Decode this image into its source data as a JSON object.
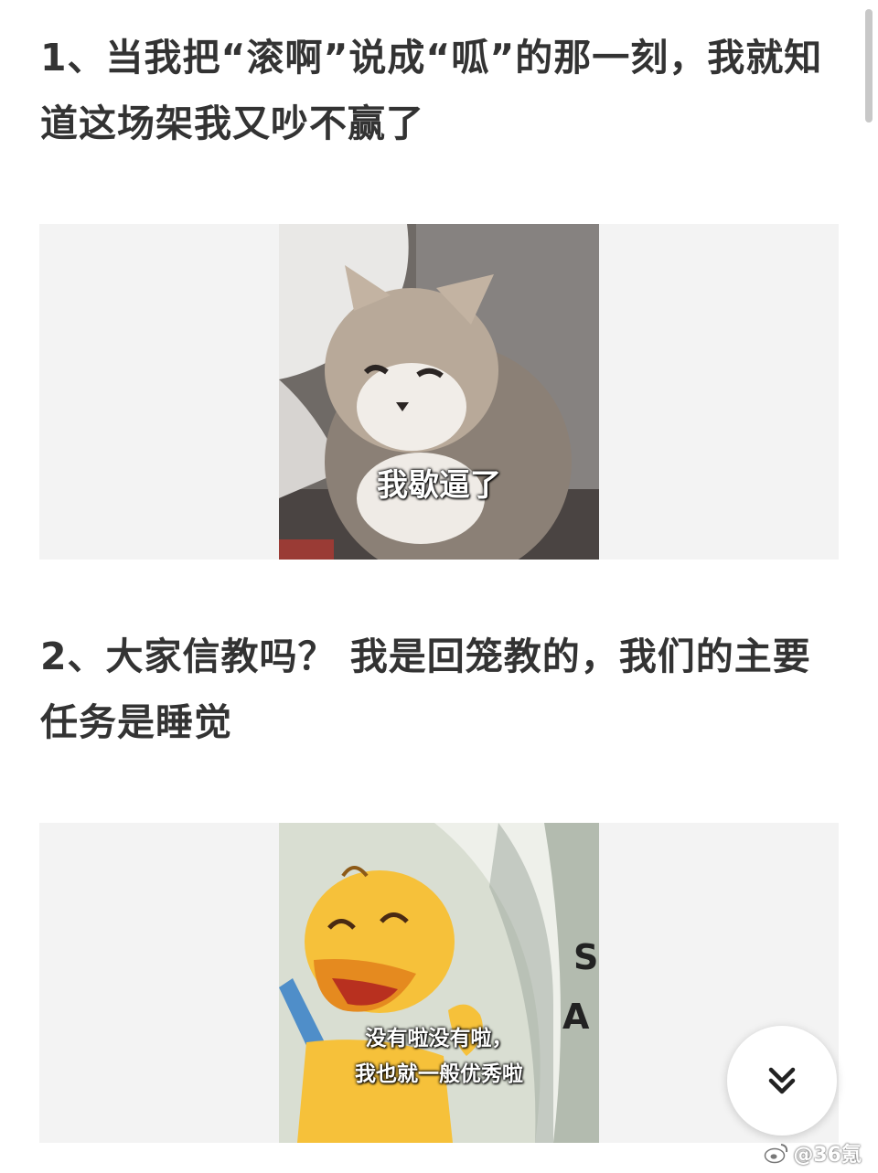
{
  "posts": [
    {
      "text": "1、当我把“滚啊”说成“呱”的那一刻，我就知道这场架我又吵不赢了",
      "meme_caption": "我歇逼了",
      "meme_icon": "cat-image"
    },
    {
      "text": "2、大家信教吗？ 我是回笼教的，我们的主要任务是睡觉",
      "meme_caption_line1": "没有啦没有啦，",
      "meme_caption_line2": "我也就一般优秀啦",
      "meme_icon": "duck-image",
      "background_text": "S A"
    }
  ],
  "scroll_button": {
    "icon": "double-chevron-down-icon"
  },
  "watermark": {
    "icon": "weibo-icon",
    "text": "@36氪"
  },
  "colors": {
    "text": "#333333",
    "frame_bg": "#f3f3f3",
    "duck_yellow": "#f6c13a"
  }
}
